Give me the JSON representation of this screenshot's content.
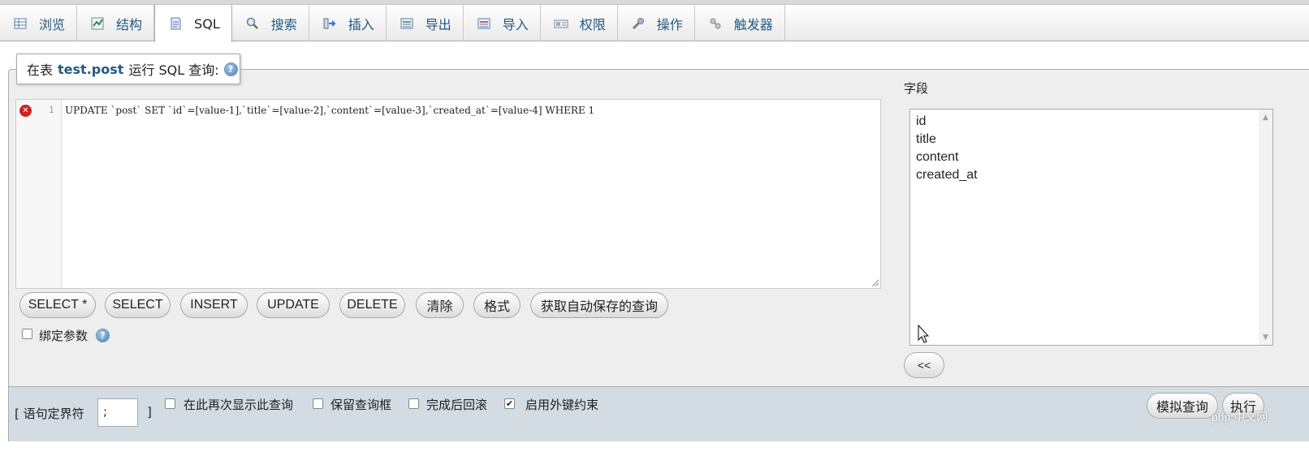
{
  "tabs": [
    {
      "label": "浏览",
      "icon": "table-browse-icon"
    },
    {
      "label": "结构",
      "icon": "structure-icon"
    },
    {
      "label": "SQL",
      "icon": "sql-icon",
      "active": true
    },
    {
      "label": "搜索",
      "icon": "search-icon"
    },
    {
      "label": "插入",
      "icon": "insert-icon"
    },
    {
      "label": "导出",
      "icon": "export-icon"
    },
    {
      "label": "导入",
      "icon": "import-icon"
    },
    {
      "label": "权限",
      "icon": "privileges-icon"
    },
    {
      "label": "操作",
      "icon": "wrench-icon"
    },
    {
      "label": "触发器",
      "icon": "triggers-icon"
    }
  ],
  "query_header": {
    "prefix": "在表",
    "table": "test.post",
    "suffix": "运行 SQL 查询:"
  },
  "editor": {
    "line_number": "1",
    "code": "UPDATE `post` SET `id`=[value-1],`title`=[value-2],`content`=[value-3],`created_at`=[value-4] WHERE 1"
  },
  "buttons": {
    "select_all": "SELECT *",
    "select": "SELECT",
    "insert": "INSERT",
    "update": "UPDATE",
    "delete": "DELETE",
    "clear": "清除",
    "format": "格式",
    "get_autosaved": "获取自动保存的查询"
  },
  "bind_params": {
    "label": "绑定参数",
    "checked": false
  },
  "columns": {
    "title": "字段",
    "items": [
      "id",
      "title",
      "content",
      "created_at"
    ],
    "insert_button": "<<"
  },
  "footer": {
    "delimiter_label": "[ 语句定界符",
    "delimiter_value": ";",
    "delimiter_close": "]",
    "show_again": {
      "label": "在此再次显示此查询",
      "checked": false
    },
    "keep_box": {
      "label": "保留查询框",
      "checked": false
    },
    "rollback": {
      "label": "完成后回滚",
      "checked": false
    },
    "foreign_keys": {
      "label": "启用外键约束",
      "checked": true
    },
    "simulate_button": "模拟查询",
    "go_button": "执行"
  },
  "watermark": "php 中文网",
  "colors": {
    "link": "#235a81",
    "panel_bg": "#eeeeee",
    "footer_bg": "#d3dce3"
  }
}
